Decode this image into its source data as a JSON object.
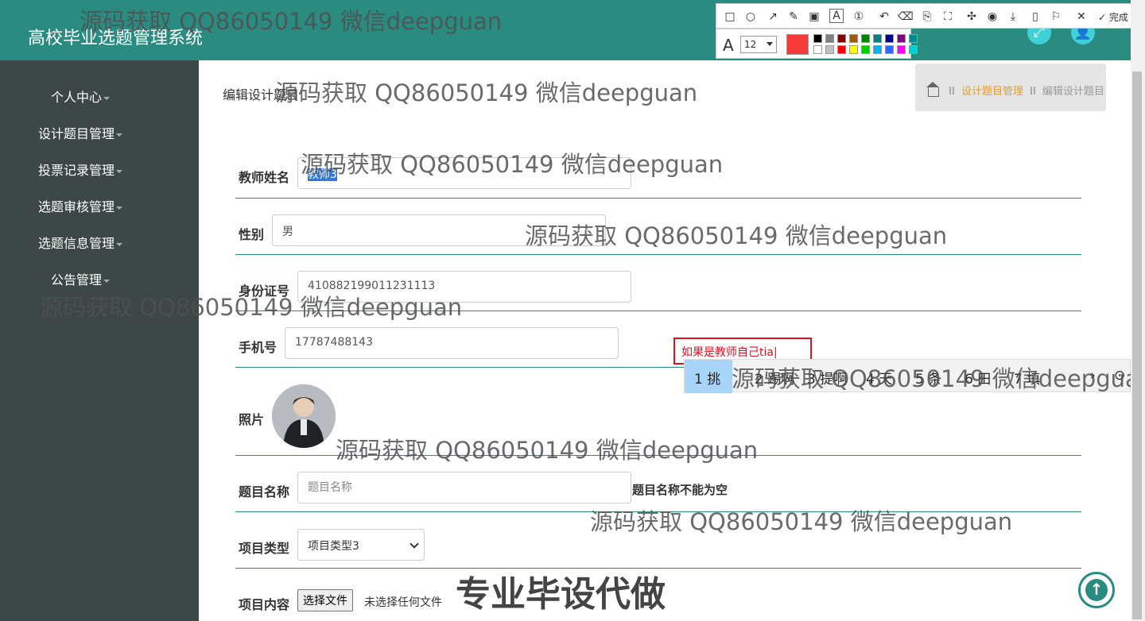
{
  "header": {
    "title": "高校毕业选题管理系统"
  },
  "sidebar": {
    "items": [
      {
        "label": "个人中心"
      },
      {
        "label": "设计题目管理"
      },
      {
        "label": "投票记录管理"
      },
      {
        "label": "选题审核管理"
      },
      {
        "label": "选题信息管理"
      },
      {
        "label": "公告管理"
      }
    ]
  },
  "page": {
    "heading": "编辑设计题目"
  },
  "breadcrumb": {
    "sep": "II",
    "current": "设计题目管理",
    "leaf": "编辑设计题目"
  },
  "form": {
    "teacher_name": {
      "label": "教师姓名",
      "value": "教师3"
    },
    "gender": {
      "label": "性别",
      "value": "男"
    },
    "id_number": {
      "label": "身份证号",
      "value": "410882199011231113"
    },
    "phone": {
      "label": "手机号",
      "value": "17787488143"
    },
    "photo": {
      "label": "照片"
    },
    "topic_name": {
      "label": "题目名称",
      "placeholder": "题目名称",
      "error": "题目名称不能为空"
    },
    "project_type": {
      "label": "项目类型",
      "value": "项目类型3"
    },
    "project_content": {
      "label": "项目内容",
      "button": "选择文件",
      "status": "未选择任何文件"
    }
  },
  "annotation": {
    "text": "如果是教师自己tia"
  },
  "ime": {
    "candidates": [
      "1 挑",
      "2 踢啊",
      "3 提啊",
      "4 天",
      "5 条",
      "6 田",
      "7 填"
    ]
  },
  "toolbar": {
    "done_label": "完成",
    "font_size": "12"
  },
  "colors": {
    "accent": "#2a8c80",
    "sidebar": "#3d4747",
    "current_color": "#f53a3a",
    "palette": [
      "#000000",
      "#808080",
      "#800000",
      "#a05a00",
      "#008000",
      "#008080",
      "#000080",
      "#800080",
      "#008b8b",
      "#ffffff",
      "#c0c0c0",
      "#ff0000",
      "#ffff00",
      "#00cc00",
      "#00b0f0",
      "#3366ff",
      "#ff00ff",
      "#00d0d0"
    ]
  },
  "watermark": {
    "text": "源码获取 QQ86050149 微信deepguan",
    "big": "专业毕设代做"
  }
}
